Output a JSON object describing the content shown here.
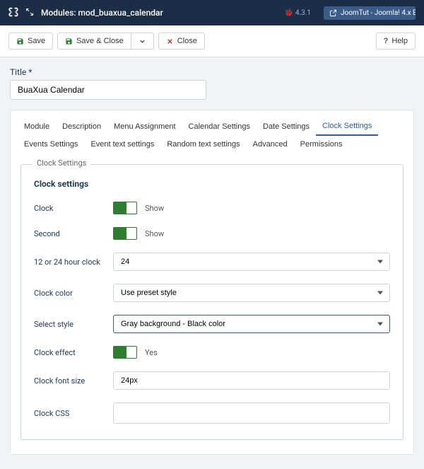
{
  "topbar": {
    "title": "Modules: mod_buaxua_calendar",
    "version": "4.3.1",
    "ext_label": "JoomTut - Joomla! 4.x Extens..."
  },
  "toolbar": {
    "save": "Save",
    "save_close": "Save & Close",
    "close": "Close",
    "help": "Help"
  },
  "title_field": {
    "label": "Title",
    "required": "*",
    "value": "BuaXua Calendar"
  },
  "tabs": [
    {
      "label": "Module",
      "active": false
    },
    {
      "label": "Description",
      "active": false
    },
    {
      "label": "Menu Assignment",
      "active": false
    },
    {
      "label": "Calendar Settings",
      "active": false
    },
    {
      "label": "Date Settings",
      "active": false
    },
    {
      "label": "Clock Settings",
      "active": true
    },
    {
      "label": "Events Settings",
      "active": false
    },
    {
      "label": "Event text settings",
      "active": false
    },
    {
      "label": "Random text settings",
      "active": false
    },
    {
      "label": "Advanced",
      "active": false
    },
    {
      "label": "Permissions",
      "active": false
    }
  ],
  "fieldset": {
    "legend": "Clock Settings",
    "heading": "Clock settings",
    "rows": {
      "clock": {
        "label": "Clock",
        "state": "Show"
      },
      "second": {
        "label": "Second",
        "state": "Show"
      },
      "hour_format": {
        "label": "12 or 24 hour clock",
        "value": "24"
      },
      "clock_color": {
        "label": "Clock color",
        "value": "Use preset style"
      },
      "select_style": {
        "label": "Select style",
        "value": "Gray background - Black color"
      },
      "clock_effect": {
        "label": "Clock effect",
        "state": "Yes"
      },
      "clock_font_size": {
        "label": "Clock font size",
        "value": "24px"
      },
      "clock_css": {
        "label": "Clock CSS",
        "value": ""
      }
    }
  }
}
